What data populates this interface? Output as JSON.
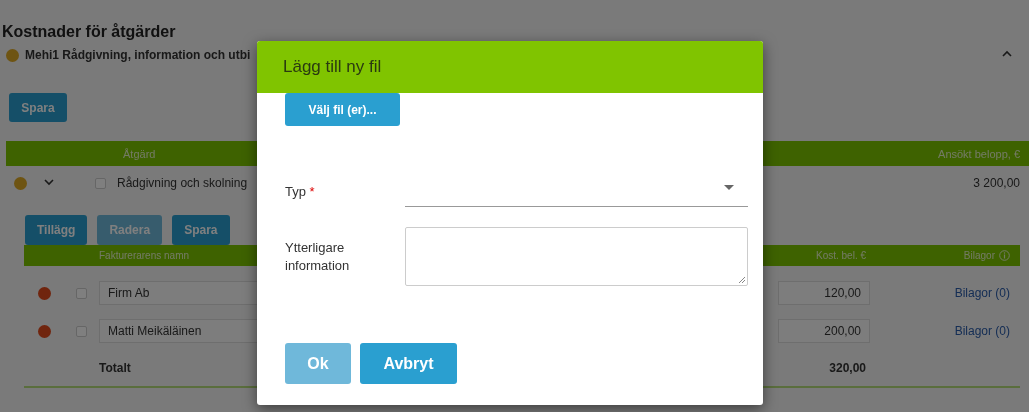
{
  "page_title": "Kostnader för åtgärder",
  "section": {
    "color": "#6e5412",
    "title": "Mehi1 Rådgivning, information och utbi",
    "expanded": true
  },
  "save_button": {
    "label": "Spara",
    "disabled": false
  },
  "measures_table": {
    "columns": [
      "Åtgärd",
      "Ansökt belopp, €"
    ],
    "rows": [
      {
        "color": "#6e5412",
        "expanded": true,
        "checked": false,
        "name": "Rådgivning och skolning",
        "amount": "3 200,00"
      }
    ]
  },
  "invoice_toolbar": [
    {
      "label": "Tillägg",
      "disabled": false
    },
    {
      "label": "Radera",
      "disabled": true
    },
    {
      "label": "Spara",
      "disabled": false
    }
  ],
  "invoice_table": {
    "columns": [
      "Fakturerarens namn",
      "Kost. bel. €",
      "Bilagor"
    ],
    "rows": [
      {
        "color": "#70250e",
        "checked": false,
        "name": "Firm Ab",
        "cost": "120,00",
        "attachments": "Bilagor (0)"
      },
      {
        "color": "#70250e",
        "checked": false,
        "name": "Matti Meikäläinen",
        "cost": "200,00",
        "attachments": "Bilagor (0)"
      }
    ],
    "total_label": "Totalt",
    "total": "320,00"
  },
  "dialog": {
    "title": "Lägg till ny fil",
    "choose_button": "Välj fil (er)...",
    "fields": [
      {
        "kind": "select",
        "label": "Typ",
        "required_mark": "*"
      },
      {
        "kind": "textarea",
        "label": "Ytterligare information"
      }
    ],
    "buttons": [
      {
        "label": "Ok",
        "disabled": true
      },
      {
        "label": "Avbryt",
        "disabled": false
      }
    ]
  }
}
